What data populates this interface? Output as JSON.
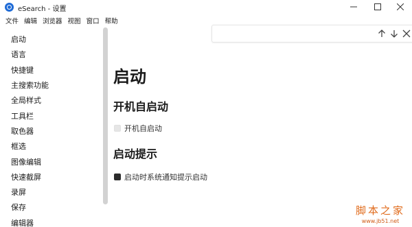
{
  "window": {
    "title": "eSearch - 设置",
    "controls": {
      "minimize": "minimize-icon",
      "maximize": "maximize-icon",
      "close": "close-icon"
    }
  },
  "menubar": {
    "items": [
      "文件",
      "编辑",
      "浏览器",
      "视图",
      "窗口",
      "帮助"
    ]
  },
  "findbar": {
    "value": "",
    "icons": [
      "arrow-up-icon",
      "arrow-down-icon",
      "close-icon"
    ]
  },
  "sidebar": {
    "items": [
      "启动",
      "语言",
      "快捷键",
      "主搜索功能",
      "全局样式",
      "工具栏",
      "取色器",
      "框选",
      "图像编辑",
      "快速截屏",
      "录屏",
      "保存",
      "编辑器"
    ]
  },
  "main": {
    "title": "启动",
    "sections": [
      {
        "title": "开机自启动",
        "option": {
          "label": "开机自启动",
          "checked": false
        }
      },
      {
        "title": "启动提示",
        "option": {
          "label": "启动时系统通知提示启动",
          "checked": true
        }
      }
    ]
  },
  "watermark": {
    "title": "脚本之家",
    "url": "www.jb51.net"
  },
  "colors": {
    "accent": "#1f6bd6",
    "checked": "#2b2b2b",
    "unchecked": "#e6e6e6",
    "watermark": "#e06a1a"
  }
}
